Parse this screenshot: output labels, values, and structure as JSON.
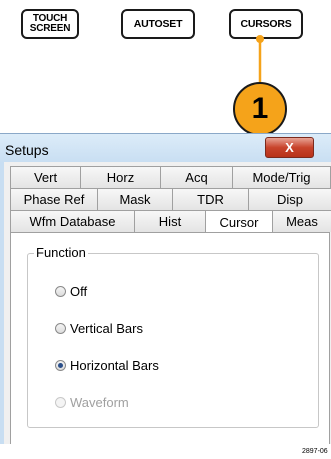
{
  "front_panel": {
    "touch_screen_line1": "TOUCH",
    "touch_screen_line2": "SCREEN",
    "autoset": "AUTOSET",
    "cursors": "CURSORS"
  },
  "callout": {
    "number": "1",
    "color": "#f5a31a"
  },
  "dialog": {
    "title": "Setups",
    "close_label": "X",
    "tabs_row1": [
      "Vert",
      "Horz",
      "Acq",
      "Mode/Trig"
    ],
    "tabs_row2": [
      "Phase Ref",
      "Mask",
      "TDR",
      "Disp"
    ],
    "tabs_row3": [
      "Wfm Database",
      "Hist",
      "Cursor",
      "Meas"
    ],
    "active_tab": "Cursor",
    "function_group": {
      "label": "Function",
      "options": [
        "Off",
        "Vertical Bars",
        "Horizontal Bars",
        "Waveform"
      ],
      "selected": "Horizontal Bars",
      "disabled": "Waveform"
    }
  },
  "figure_id": "2897-06"
}
